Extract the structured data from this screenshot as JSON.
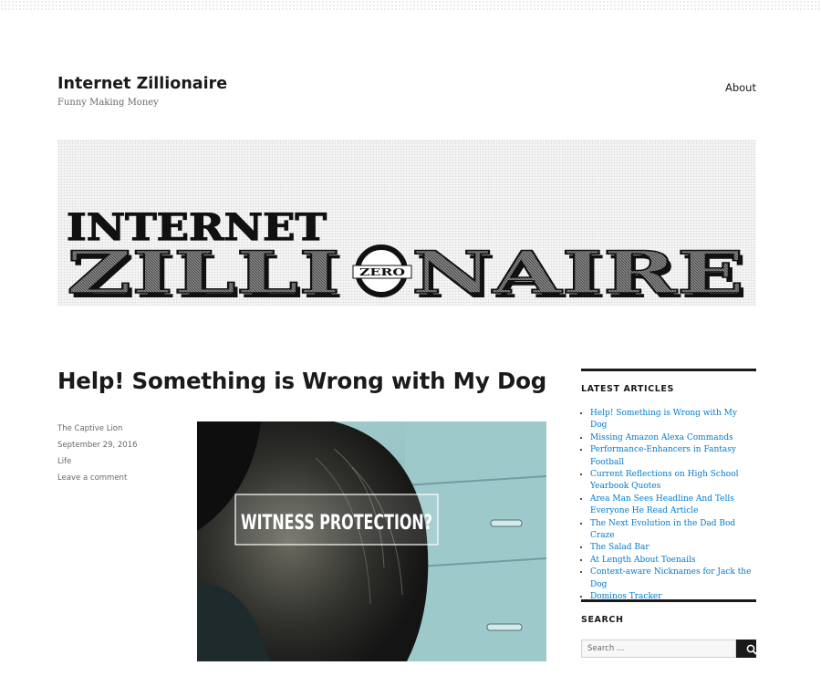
{
  "header": {
    "site_title": "Internet Zillionaire",
    "site_description": "Funny Making Money",
    "menu": [
      {
        "label": "About"
      }
    ]
  },
  "banner": {
    "line1": "INTERNET",
    "line2_left": "ZILLI",
    "line2_right": "NAIRE",
    "zero_word": "ZERO"
  },
  "article": {
    "title": "Help! Something is Wrong with My Dog",
    "author": "The Captive Lion",
    "date": "September 29, 2016",
    "category": "Life",
    "comments": "Leave a comment",
    "image_caption": "WITNESS PROTECTION?"
  },
  "sidebar": {
    "latest_title": "LATEST ARTICLES",
    "latest_articles": [
      "Help! Something is Wrong with My Dog",
      "Missing Amazon Alexa Commands",
      "Performance-Enhancers in Fantasy Football",
      "Current Reflections on High School Yearbook Quotes",
      "Area Man Sees Headline And Tells Everyone He Read Article",
      "The Next Evolution in the Dad Bod Craze",
      "The Salad Bar",
      "At Length About Toenails",
      "Context-aware Nicknames for Jack the Dog",
      "Dominos Tracker"
    ],
    "search_title": "SEARCH",
    "search_placeholder": "Search …"
  },
  "colors": {
    "link": "#007acc",
    "text": "#1a1a1a",
    "muted": "#686868"
  },
  "icons": {
    "search_button": "search-icon"
  }
}
